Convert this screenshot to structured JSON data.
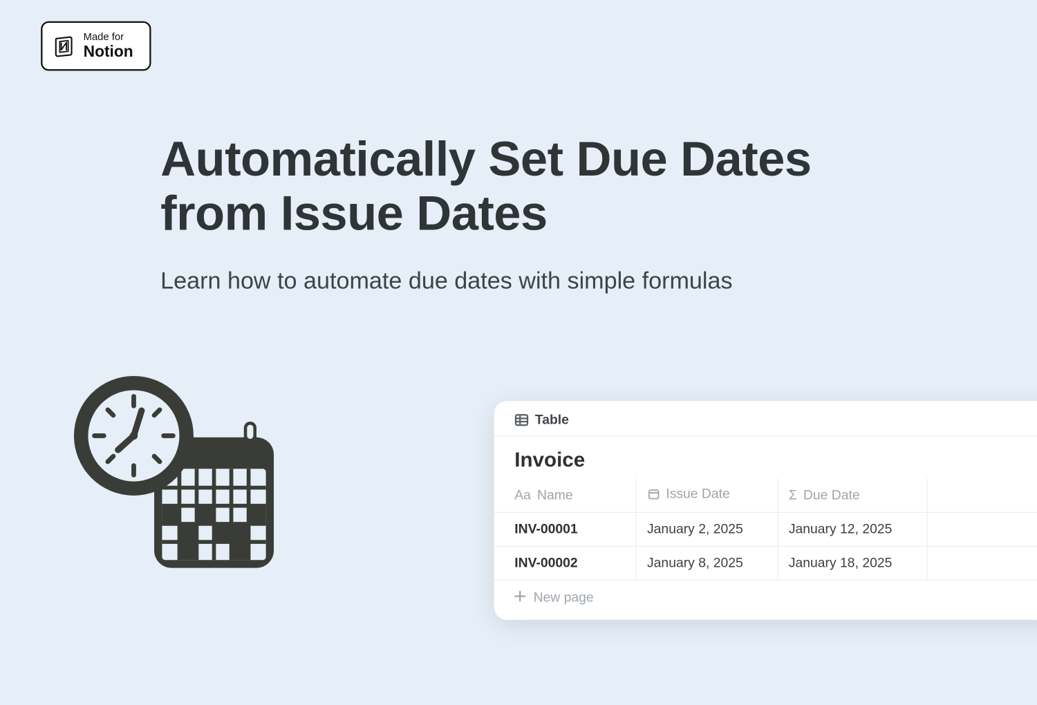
{
  "badge": {
    "made": "Made for",
    "notion": "Notion"
  },
  "hero": {
    "title": "Automatically Set Due Dates from Issue Dates",
    "subtitle": "Learn how to automate due dates with simple formulas"
  },
  "card": {
    "tab_label": "Table",
    "title": "Invoice",
    "columns": {
      "name": "Name",
      "issue": "Issue Date",
      "due": "Due Date"
    },
    "rows": [
      {
        "name": "INV-00001",
        "issue": "January 2, 2025",
        "due": "January 12, 2025"
      },
      {
        "name": "INV-00002",
        "issue": "January 8, 2025",
        "due": "January 18, 2025"
      }
    ],
    "new_page": "New page"
  }
}
